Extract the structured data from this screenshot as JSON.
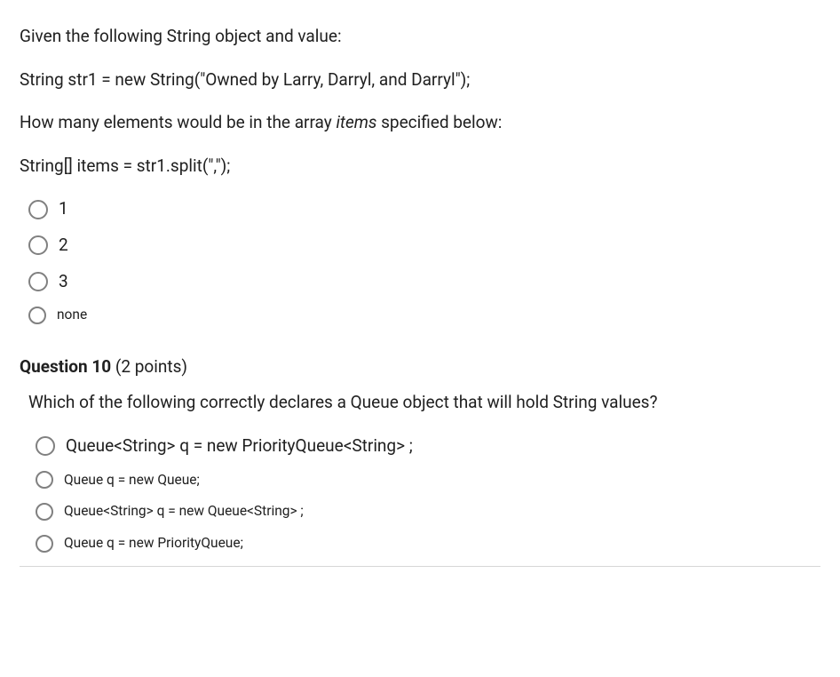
{
  "q1": {
    "stem_lines": [
      "Given the following String object and value:",
      "String str1 = new String(\"Owned by Larry, Darryl, and Darryl\");",
      "How many elements would be in the array <i>items</i> specified below:",
      "String[] items = str1.split(\",\");"
    ],
    "options": [
      "1",
      "2",
      "3",
      "none"
    ]
  },
  "q2": {
    "number": "Question 10",
    "points": "(2 points)",
    "stem": "Which of the following correctly declares a Queue object that will hold String values?",
    "options": [
      "Queue<String> q = new PriorityQueue<String> ;",
      "Queue q = new Queue;",
      "Queue<String> q = new Queue<String> ;",
      "Queue q = new PriorityQueue;"
    ]
  }
}
